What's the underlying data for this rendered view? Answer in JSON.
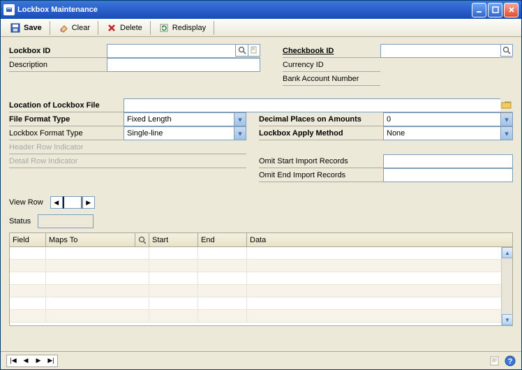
{
  "window": {
    "title": "Lockbox Maintenance"
  },
  "toolbar": {
    "save": "Save",
    "clear": "Clear",
    "delete": "Delete",
    "redisplay": "Redisplay"
  },
  "labels": {
    "lockbox_id": "Lockbox ID",
    "description": "Description",
    "checkbook_id": "Checkbook ID",
    "currency_id": "Currency ID",
    "bank_account": "Bank Account Number",
    "location": "Location of Lockbox File",
    "file_format_type": "File Format Type",
    "lockbox_format_type": "Lockbox Format Type",
    "header_row_ind": "Header Row Indicator",
    "detail_row_ind": "Detail Row Indicator",
    "decimal_places": "Decimal Places on Amounts",
    "apply_method": "Lockbox Apply Method",
    "omit_start": "Omit Start Import Records",
    "omit_end": "Omit End Import Records",
    "view_row": "View Row",
    "status": "Status"
  },
  "values": {
    "lockbox_id": "",
    "description": "",
    "checkbook_id": "",
    "currency_id": "",
    "bank_account": "",
    "location": "",
    "file_format_type": "Fixed Length",
    "lockbox_format_type": "Single-line",
    "header_row_ind": "",
    "detail_row_ind": "",
    "decimal_places": "0",
    "apply_method": "None",
    "omit_start": "",
    "omit_end": "",
    "view_row": "",
    "status": ""
  },
  "grid": {
    "columns": {
      "field": "Field",
      "maps_to": "Maps To",
      "start": "Start",
      "end": "End",
      "data": "Data"
    }
  }
}
